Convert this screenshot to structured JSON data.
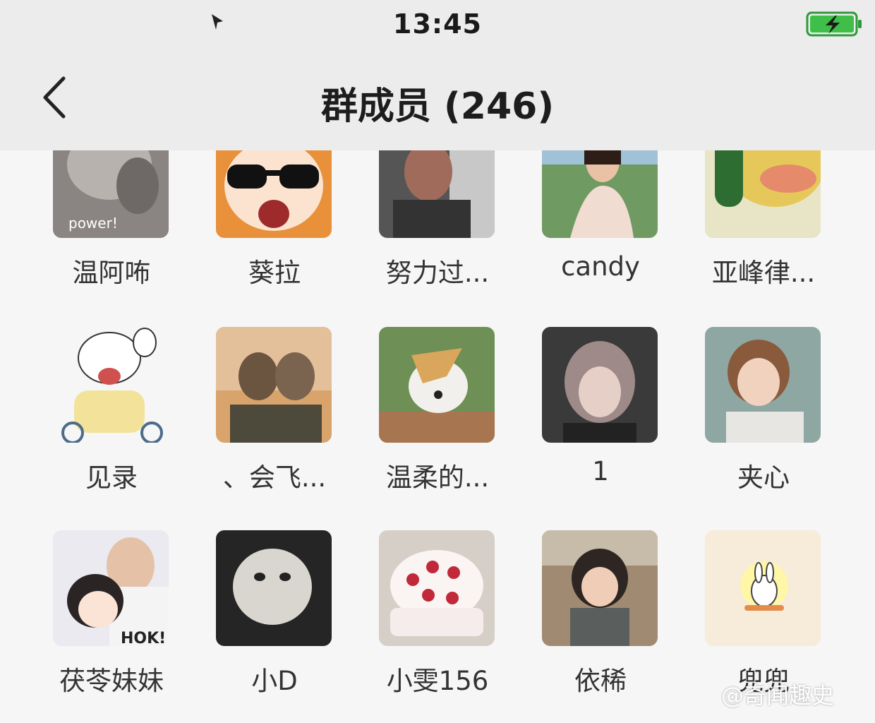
{
  "status_bar": {
    "time": "13:45"
  },
  "nav": {
    "title": "群成员 (246)"
  },
  "members": [
    {
      "name": "温阿咘",
      "avatar_text": "power!"
    },
    {
      "name": "葵拉"
    },
    {
      "name": "努力过..."
    },
    {
      "name": "candy"
    },
    {
      "name": "亚峰律..."
    },
    {
      "name": "见录"
    },
    {
      "name": "、会飞..."
    },
    {
      "name": "温柔的..."
    },
    {
      "name": "1"
    },
    {
      "name": "夹心"
    },
    {
      "name": "茯苓妹妹",
      "avatar_text": "HOK!"
    },
    {
      "name": "小D"
    },
    {
      "name": "小雯156"
    },
    {
      "name": "依稀"
    },
    {
      "name": "兜兜"
    }
  ],
  "watermark": {
    "text": "@奇闻趣史"
  }
}
